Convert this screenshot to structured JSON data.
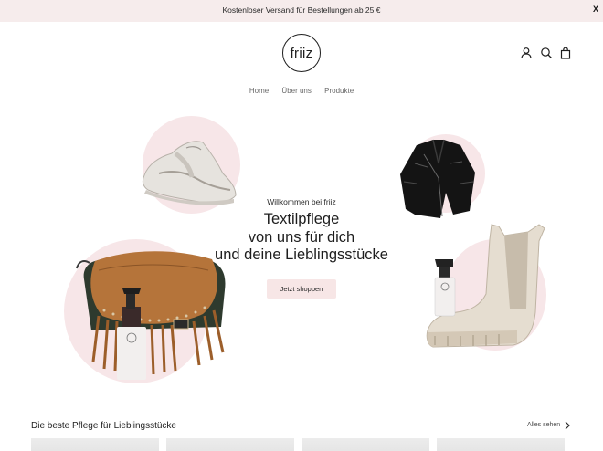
{
  "announcement": {
    "text": "Kostenloser Versand für Bestellungen ab 25 €",
    "close_label": "X"
  },
  "header": {
    "logo_text": "friiz",
    "icons": [
      "user-icon",
      "search-icon",
      "cart-icon"
    ]
  },
  "nav": {
    "items": [
      "Home",
      "Über uns",
      "Produkte"
    ]
  },
  "hero": {
    "welcome": "Willkommen bei friiz",
    "title_lines": [
      "Textilpflege",
      "von uns für dich",
      "und deine Lieblingsstücke"
    ],
    "button_label": "Jetzt shoppen"
  },
  "section": {
    "title": "Die beste Pflege für Lieblingsstücke",
    "see_all_label": "Alles sehen"
  },
  "colors": {
    "announcement_bg": "#f6ecec",
    "accent_pink": "#f7e6e8",
    "text": "#1e1e1e"
  }
}
